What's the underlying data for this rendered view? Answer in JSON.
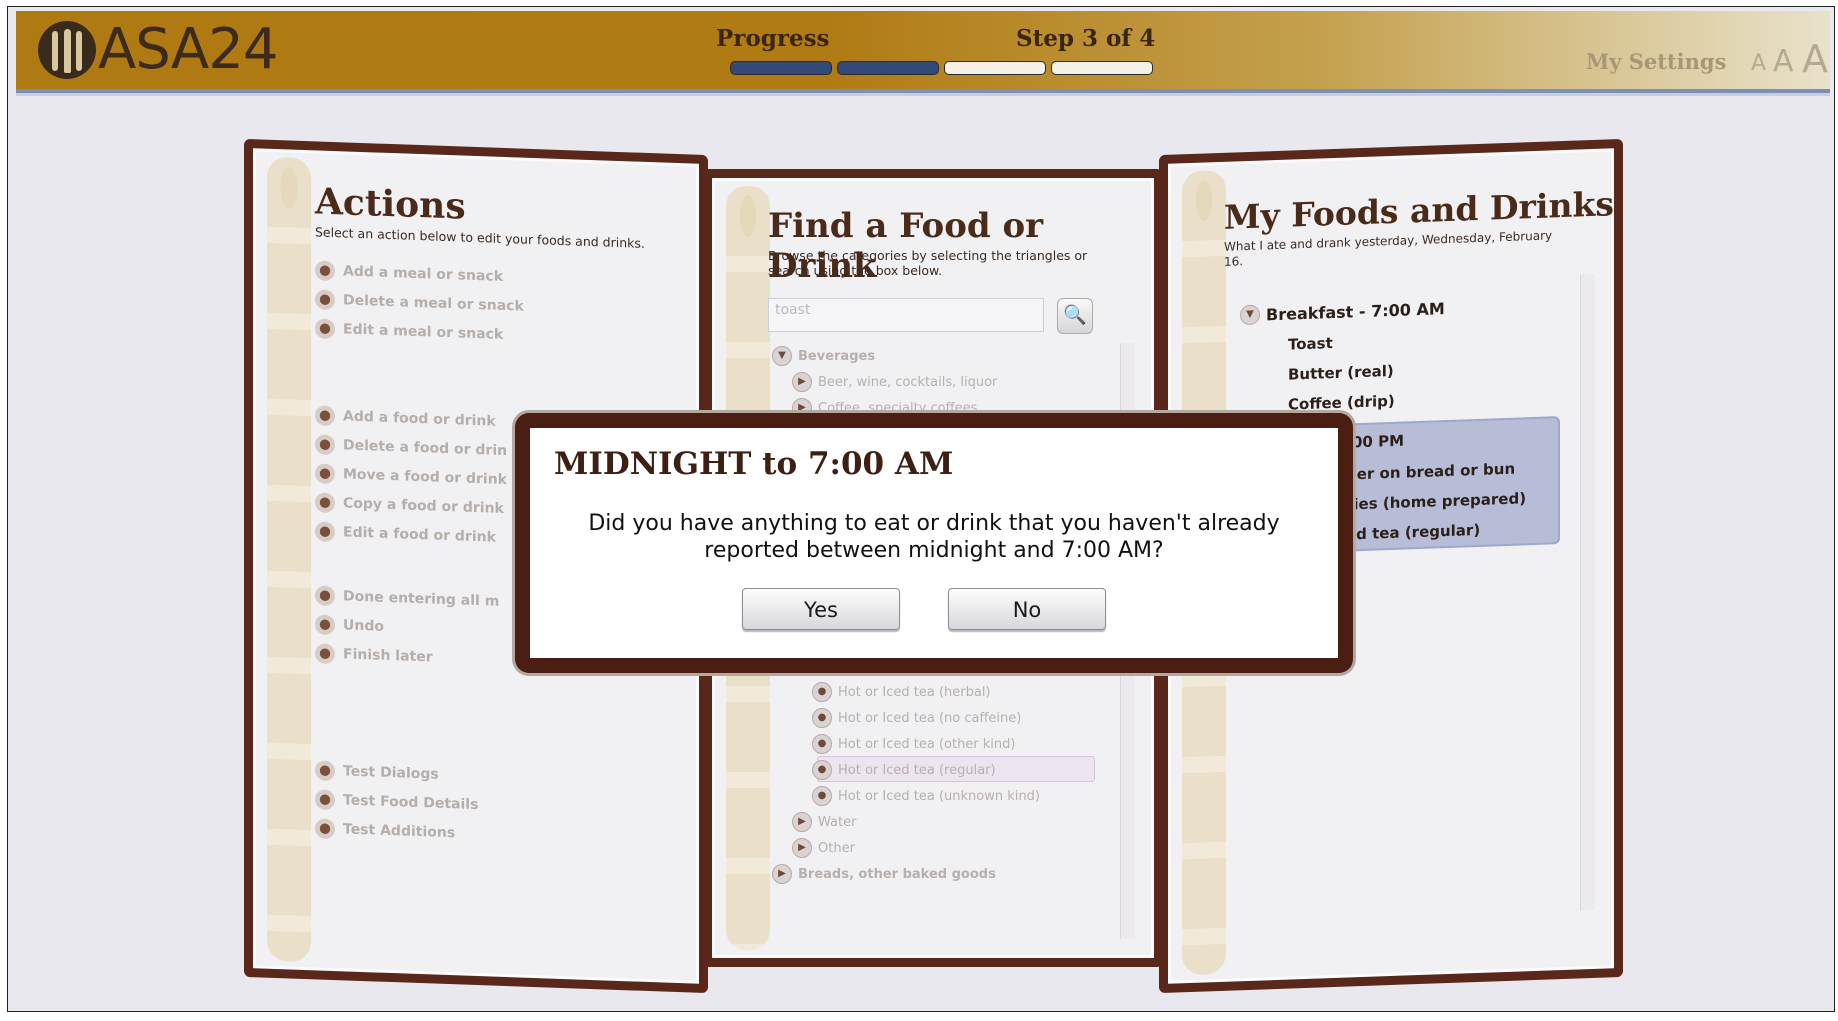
{
  "header": {
    "app_name": "ASA24",
    "progress_label": "Progress",
    "step_label": "Step 3 of 4",
    "progress": {
      "completed_steps": 2,
      "total_steps": 4
    },
    "settings_label": "My Settings",
    "text_size_options": [
      "A",
      "A",
      "A"
    ]
  },
  "actions_panel": {
    "title": "Actions",
    "subtitle": "Select an action below to edit your foods and drinks.",
    "groups": [
      [
        "Add a meal or snack",
        "Delete a meal or snack",
        "Edit a meal or snack"
      ],
      [
        "Add a food or drink",
        "Delete a food or drin",
        "Move a food or drink",
        "Copy a food or drink",
        "Edit a food or drink"
      ],
      [
        "Done entering all m",
        "Undo",
        "Finish later"
      ],
      [
        "Test Dialogs",
        "Test Food Details",
        "Test Additions"
      ]
    ]
  },
  "find_panel": {
    "title": "Find a Food or Drink",
    "subtitle_line1": "Browse the categories by selecting the triangles or",
    "subtitle_line2": "search using the box below.",
    "search_placeholder": "toast",
    "tree_top": [
      {
        "label": "Beverages",
        "level": 0,
        "icon": "expanded-triangle-icon"
      },
      {
        "label": "Beer, wine, cocktails, liquor",
        "level": 1,
        "icon": "collapsed-triangle-icon"
      },
      {
        "label": "Coffee, specialty coffees",
        "level": 1,
        "icon": "collapsed-triangle-icon"
      }
    ],
    "tree_bottom": [
      {
        "label": "Hot or Iced tea (herbal)",
        "level": 2,
        "icon": "bullet-icon"
      },
      {
        "label": "Hot or Iced tea (no caffeine)",
        "level": 2,
        "icon": "bullet-icon"
      },
      {
        "label": "Hot or Iced tea (other kind)",
        "level": 2,
        "icon": "bullet-icon"
      },
      {
        "label": "Hot or Iced tea (regular)",
        "level": 2,
        "icon": "bullet-icon",
        "selected": true
      },
      {
        "label": "Hot or Iced tea (unknown kind)",
        "level": 2,
        "icon": "bullet-icon"
      },
      {
        "label": "Water",
        "level": 1,
        "icon": "collapsed-triangle-icon"
      },
      {
        "label": "Other",
        "level": 1,
        "icon": "collapsed-triangle-icon"
      },
      {
        "label": "Breads, other baked goods",
        "level": 0,
        "icon": "collapsed-triangle-icon"
      }
    ]
  },
  "my_foods_panel": {
    "title": "My Foods and Drinks",
    "subtitle_line1": "What I ate and drank  yesterday, Wednesday, February",
    "subtitle_line2": "16.",
    "breakfast": {
      "label": "Breakfast - 7:00 AM",
      "items": [
        "Toast",
        "Butter (real)",
        "Coffee (drip)"
      ]
    },
    "second_meal_partial": {
      "time_fragment": ":00 PM",
      "items": [
        "ger on bread or bun",
        "ries (home prepared)",
        "ed tea (regular)"
      ]
    }
  },
  "dialog": {
    "title": "MIDNIGHT to 7:00 AM",
    "message_line1": "Did you have anything to eat or drink that you haven't already",
    "message_line2": "reported between midnight and 7:00 AM?",
    "yes_label": "Yes",
    "no_label": "No"
  },
  "colors": {
    "header_gold": "#b07a12",
    "panel_border": "#5a281a",
    "progress_done": "#344a76",
    "dialog_border": "#4a1e12",
    "meal_highlight": "#b7bdd7"
  }
}
